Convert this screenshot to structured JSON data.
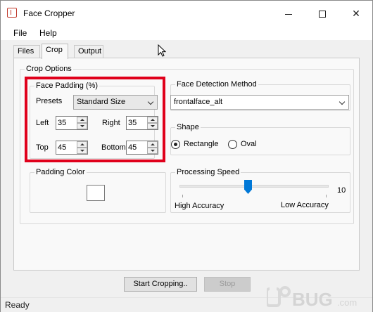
{
  "window": {
    "title": "Face Cropper"
  },
  "menu": {
    "file": "File",
    "help": "Help"
  },
  "tabs": [
    {
      "label": "Files"
    },
    {
      "label": "Crop"
    },
    {
      "label": "Output"
    }
  ],
  "crop_options": {
    "title": "Crop Options",
    "face_padding": {
      "title": "Face Padding (%)",
      "presets_label": "Presets",
      "presets_value": "Standard Size",
      "left_label": "Left",
      "left_value": "35",
      "right_label": "Right",
      "right_value": "35",
      "top_label": "Top",
      "top_value": "45",
      "bottom_label": "Bottom",
      "bottom_value": "45"
    },
    "face_detection": {
      "title": "Face Detection Method",
      "value": "frontalface_alt"
    },
    "shape": {
      "title": "Shape",
      "rectangle": "Rectangle",
      "oval": "Oval",
      "selected": "Rectangle"
    },
    "padding_color": {
      "title": "Padding Color",
      "color": "#ffffff"
    },
    "processing_speed": {
      "title": "Processing Speed",
      "value": "10",
      "high_label": "High Accuracy",
      "low_label": "Low Accuracy"
    }
  },
  "buttons": {
    "start": "Start Cropping..",
    "stop": "Stop"
  },
  "status": {
    "text": "Ready"
  },
  "watermark": "UEBUG.com",
  "colors": {
    "highlight": "#e0001b",
    "accent": "#0078d7"
  }
}
